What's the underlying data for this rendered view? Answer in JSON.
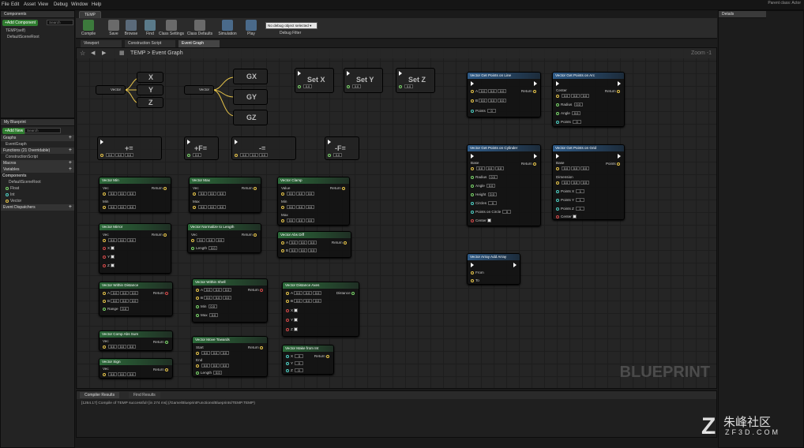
{
  "menu": [
    "File",
    "Edit",
    "Asset",
    "View",
    "Debug",
    "Window",
    "Help"
  ],
  "topright": "Parent class: Actor",
  "doc_tab": "TEMP",
  "components": {
    "title": "Components",
    "add": "+Add Component",
    "search": "Search",
    "items": [
      "TEMP(self)",
      "DefaultSceneRoot"
    ]
  },
  "toolbar": [
    {
      "label": "Compile"
    },
    {
      "label": "Save"
    },
    {
      "label": "Browse"
    },
    {
      "label": "Find"
    },
    {
      "label": "Class Settings"
    },
    {
      "label": "Class Defaults"
    },
    {
      "label": "Simulation"
    },
    {
      "label": "Play"
    }
  ],
  "debug": {
    "value": "No debug object selected ▾",
    "label": "Debug Filter"
  },
  "editor_tabs": [
    "Viewport",
    "Construction Script",
    "Event Graph"
  ],
  "breadcrumb": "TEMP > Event Graph",
  "zoom": "Zoom -1",
  "watermark": "BLUEPRINT",
  "mybp": {
    "title": "My Blueprint",
    "add": "+Add New",
    "search": "Search",
    "sections": [
      {
        "label": "Graphs",
        "items": [
          "EventGraph"
        ]
      },
      {
        "label": "Functions (21 Overridable)",
        "items": [
          "ConstructionScript"
        ]
      },
      {
        "label": "Macros",
        "items": []
      },
      {
        "label": "Variables",
        "items": [
          "Components",
          "DefaultSceneRoot",
          "Float",
          "Int",
          "Vector"
        ]
      },
      {
        "label": "Event Dispatchers",
        "items": []
      }
    ]
  },
  "details": {
    "title": "Details"
  },
  "log": {
    "tabs": [
      "Compiler Results",
      "Find Results"
    ],
    "line": "[1264.17] Compile of TEMP successful! [in 274 ms] (/Game/BlueprintFunctions/Blueprints/TEMP.TEMP)",
    "clear": "Clear"
  },
  "brand": {
    "name": "朱峰社区",
    "url": "ZF3D.COM"
  },
  "nodes": {
    "break_inputs": "Vector",
    "split_labels": [
      "X",
      "Y",
      "Z"
    ],
    "gsplit": [
      "GX",
      "GY",
      "GZ"
    ],
    "setters": [
      "Set X",
      "Set Y",
      "Set Z"
    ],
    "ops": [
      "+=",
      "+F=",
      "-=",
      "-F="
    ],
    "fn": [
      "Vector Min",
      "Vector Max",
      "Vector Clamp",
      "Vector Mirror",
      "Vector Normalize to Length",
      "Vector Abs Diff",
      "Vector Within Distance",
      "Vector Within Shell",
      "Vector Distance Axes",
      "Vector Comp Abs Sum",
      "Vector Move Towards",
      "Vector Sign",
      "Vector Make from Int"
    ],
    "right": [
      "Vector Get Points on Line",
      "Vector Get Points on Arc",
      "Vector Get Points on Cylinder",
      "Vector Get Points on Grid",
      "Vector Array Add Array"
    ],
    "pins": {
      "return": "Return",
      "vec": "Vec",
      "min": "Min",
      "max": "Max",
      "value": "Value",
      "a": "A",
      "b": "B",
      "x": "X",
      "y": "Y",
      "z": "Z",
      "length": "Length",
      "range": "Range",
      "distance": "Distance",
      "start": "Start",
      "end": "End",
      "points": "Points",
      "center": "Center",
      "radius": "Radius",
      "angle": "Angle",
      "height": "Height",
      "circles": "Circles",
      "points_on_circle": "Points on Circle",
      "base": "Base",
      "dimension": "Dimension",
      "points_x": "Points X",
      "points_y": "Points Y",
      "points_z": "Points Z",
      "from": "From",
      "to": "To"
    },
    "zero": "0.0",
    "zero3": [
      "0.0",
      "0.0",
      "0.0"
    ]
  }
}
